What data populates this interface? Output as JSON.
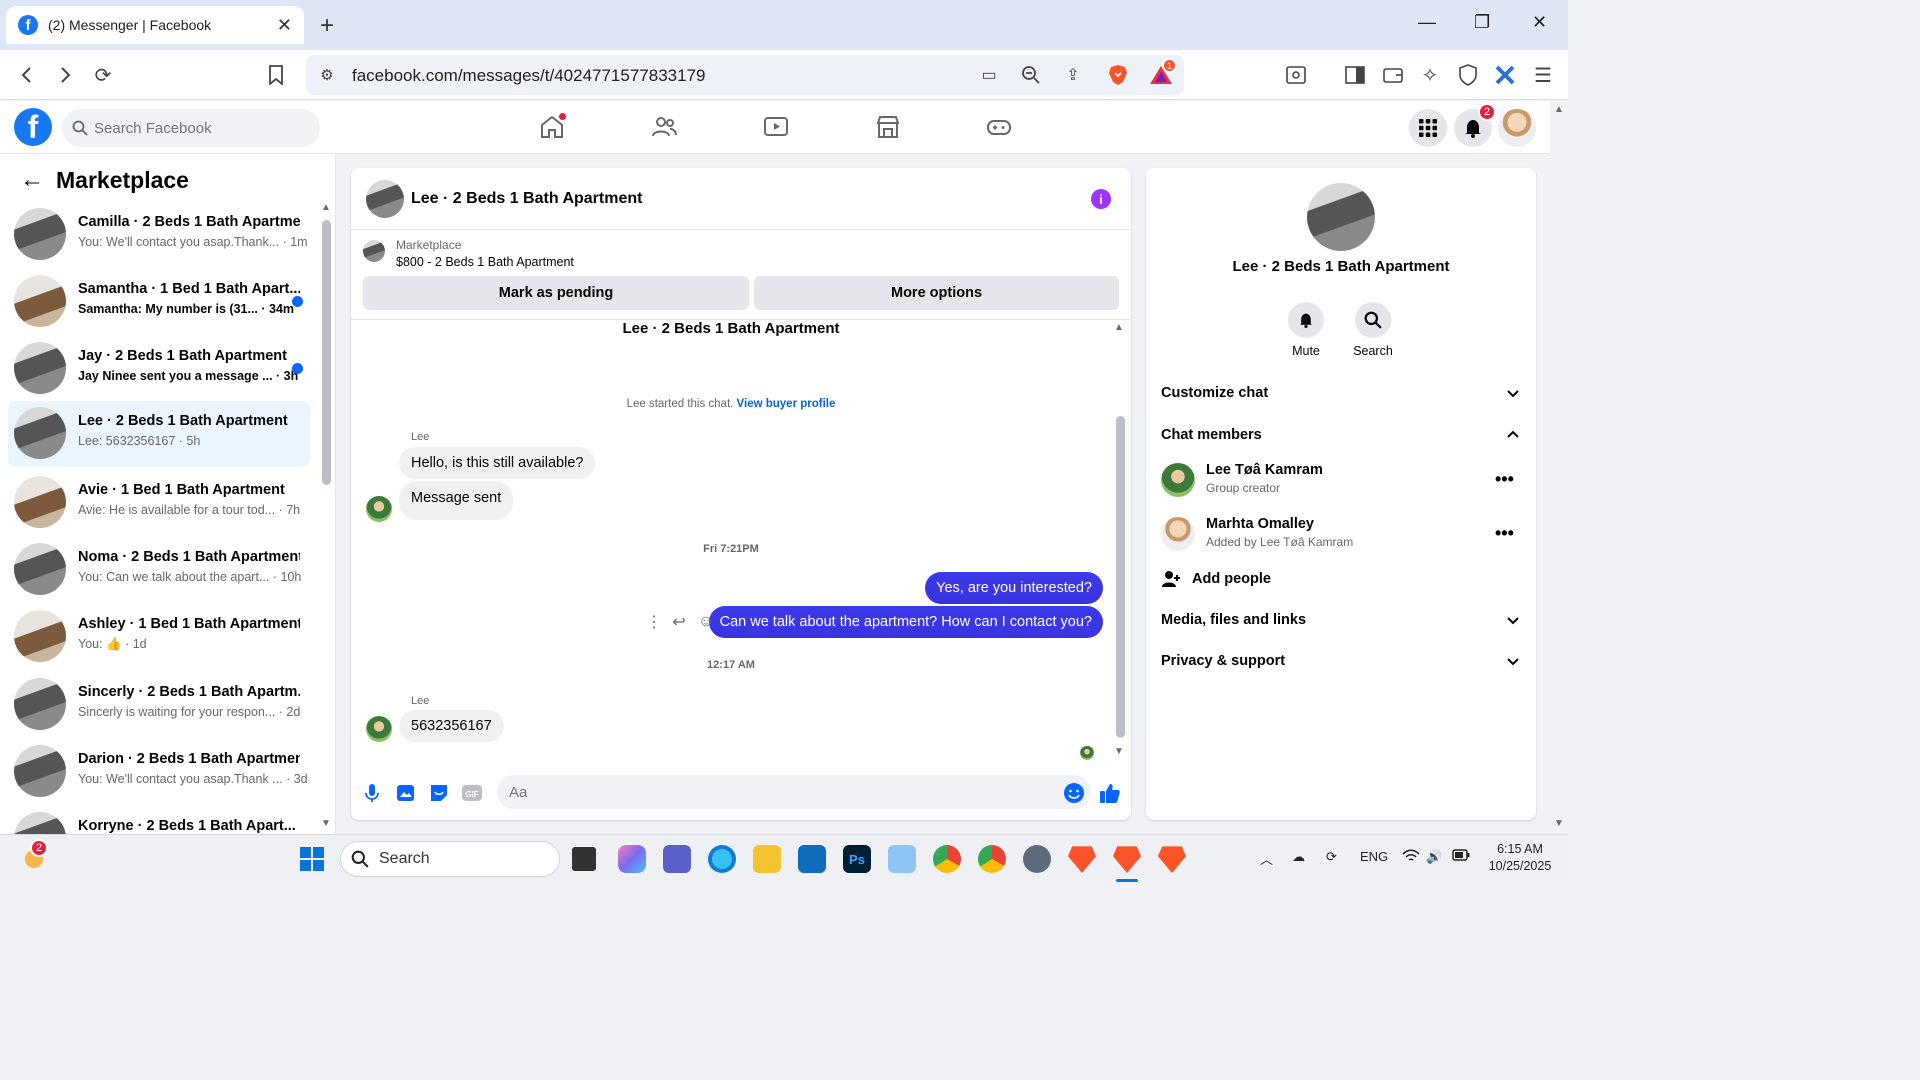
{
  "browser": {
    "tab_title": "(2) Messenger | Facebook",
    "url": "facebook.com/messages/t/4024771577833179",
    "brave_badge": "1"
  },
  "fb": {
    "search_placeholder": "Search Facebook",
    "notif_count": "2"
  },
  "left": {
    "title": "Marketplace",
    "conversations": [
      {
        "name": "Camilla · 2 Beds 1 Bath Apartme...",
        "preview": "You: We'll contact you asap.Thank... · 1m",
        "unread": false
      },
      {
        "name": "Samantha · 1 Bed 1 Bath Apart...",
        "preview": "Samantha: My number is (31... · 34m",
        "unread": true
      },
      {
        "name": "Jay · 2 Beds 1 Bath Apartment",
        "preview": "Jay Ninee sent you a message ... · 3h",
        "unread": true
      },
      {
        "name": "Lee · 2 Beds 1 Bath Apartment",
        "preview": "Lee: 5632356167 · 5h",
        "unread": false
      },
      {
        "name": "Avie · 1 Bed 1 Bath Apartment",
        "preview": "Avie: He is available for a tour tod... · 7h",
        "unread": false
      },
      {
        "name": "Noma · 2 Beds 1 Bath Apartment",
        "preview": "You: Can we talk about the apart... · 10h",
        "unread": false
      },
      {
        "name": "Ashley · 1 Bed 1 Bath Apartment",
        "preview": "You: 👍 · 1d",
        "unread": false
      },
      {
        "name": "Sincerly · 2 Beds 1 Bath Apartm...",
        "preview": "Sincerly is waiting for your respon... · 2d",
        "unread": false
      },
      {
        "name": "Darion · 2 Beds 1 Bath Apartment",
        "preview": "You: We'll contact you asap.Thank ... · 3d",
        "unread": false
      },
      {
        "name": "Korryne · 2 Beds 1 Bath Apart...",
        "preview": "",
        "unread": false
      }
    ]
  },
  "chat": {
    "title": "Lee · 2 Beds 1 Bath Apartment",
    "marketplace_label": "Marketplace",
    "listing": "$800 - 2 Beds 1 Bath Apartment",
    "btn_pending": "Mark as pending",
    "btn_more": "More options",
    "top_title": "Lee · 2 Beds 1 Bath Apartment",
    "started": "Lee started this chat.",
    "view_profile": "View buyer profile",
    "sender1": "Lee",
    "msg1": "Hello, is this still available?",
    "msg2": "Message sent",
    "time1": "Fri 7:21PM",
    "out1": "Yes, are you interested?",
    "out2": "Can we talk about the apartment? How can I contact you?",
    "time2": "12:17 AM",
    "sender2": "Lee",
    "msg3": "5632356167",
    "composer_placeholder": "Aa"
  },
  "right": {
    "title": "Lee · 2 Beds 1 Bath Apartment",
    "mute": "Mute",
    "search": "Search",
    "customize": "Customize chat",
    "members_heading": "Chat members",
    "members": [
      {
        "name": "Lee Tøâ Kamram",
        "sub": "Group creator"
      },
      {
        "name": "Marhta Omalley",
        "sub": "Added by Lee Tøâ Kamram"
      }
    ],
    "add_people": "Add people",
    "media": "Media, files and links",
    "privacy": "Privacy & support"
  },
  "taskbar": {
    "search": "Search",
    "lang": "ENG",
    "time": "6:15 AM",
    "date": "10/25/2025",
    "weather_badge": "2"
  }
}
